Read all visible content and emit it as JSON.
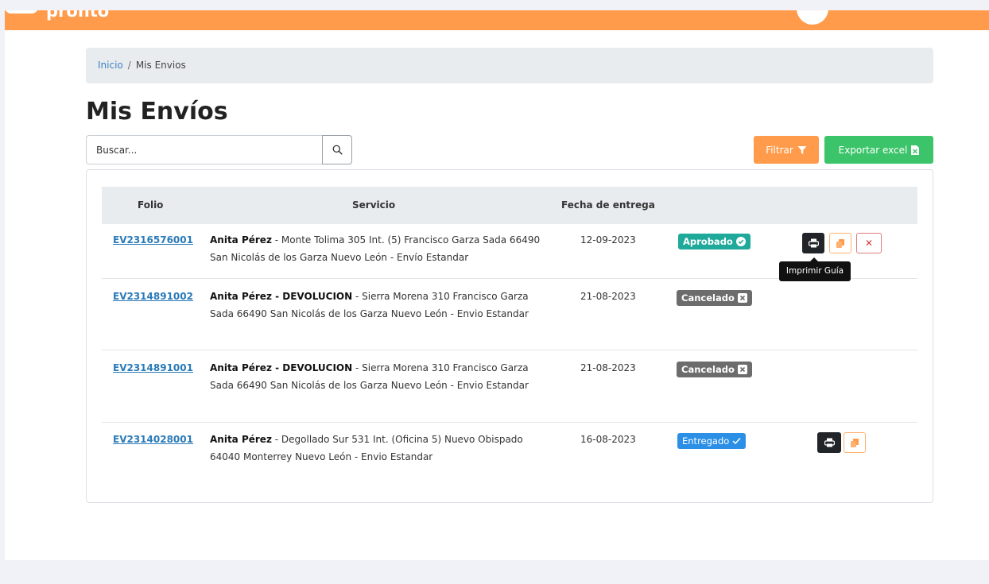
{
  "brand": {
    "logo_text": "pronto",
    "color": "#ff9b4a"
  },
  "breadcrumb": {
    "home": "Inicio",
    "separator": "/",
    "current": "Mis Envios"
  },
  "page_title": "Mis Envíos",
  "search": {
    "placeholder": "Buscar..."
  },
  "toolbar": {
    "filter_label": "Filtrar",
    "export_label": "Exportar excel"
  },
  "table": {
    "headers": {
      "folio": "Folio",
      "service": "Servicio",
      "date": "Fecha de entrega"
    },
    "rows": [
      {
        "folio": "EV2316576001",
        "name": "Anita Pérez",
        "detail": " - Monte Tolima 305 Int. (5) Francisco Garza Sada 66490 San Nicolás de los Garza Nuevo León - Envío Estandar",
        "date": "12-09-2023",
        "status": "Aprobado",
        "actions": [
          "print",
          "copy",
          "cancel"
        ]
      },
      {
        "folio": "EV2314891002",
        "name": "Anita Pérez - DEVOLUCION",
        "detail": " - Sierra Morena 310 Francisco Garza Sada 66490 San Nicolás de los Garza Nuevo León - Envio Estandar",
        "date": "21-08-2023",
        "status": "Cancelado",
        "actions": []
      },
      {
        "folio": "EV2314891001",
        "name": "Anita Pérez - DEVOLUCION",
        "detail": " - Sierra Morena 310 Francisco Garza Sada 66490 San Nicolás de los Garza Nuevo León - Envio Estandar",
        "date": "21-08-2023",
        "status": "Cancelado",
        "actions": []
      },
      {
        "folio": "EV2314028001",
        "name": "Anita Pérez",
        "detail": " - Degollado Sur 531 Int. (Oficina 5) Nuevo Obispado 64040 Monterrey Nuevo León - Envio Estandar",
        "date": "16-08-2023",
        "status": "Entregado",
        "actions": [
          "print",
          "copy"
        ]
      }
    ]
  },
  "tooltip": {
    "text": "Imprimir Guía"
  },
  "colors": {
    "aprobado": "#1fa99b",
    "cancelado": "#6c6c6c",
    "entregado": "#2b8fe6",
    "export": "#3cc46a"
  }
}
